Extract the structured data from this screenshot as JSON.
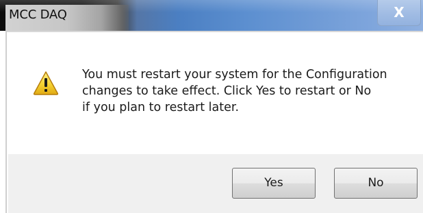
{
  "window": {
    "title": "MCC DAQ",
    "close_glyph": "X"
  },
  "dialog": {
    "icon": "warning-icon",
    "message_lines": [
      "You must restart your system for the Configuration",
      "changes to take effect. Click Yes to restart or No",
      "if you plan to restart later."
    ],
    "buttons": {
      "yes_label": "Yes",
      "no_label": "No"
    }
  },
  "colors": {
    "title_bar_accent": "#4b7fc2",
    "warning_yellow": "#f5d231",
    "footer_background": "#f0f0f0"
  }
}
